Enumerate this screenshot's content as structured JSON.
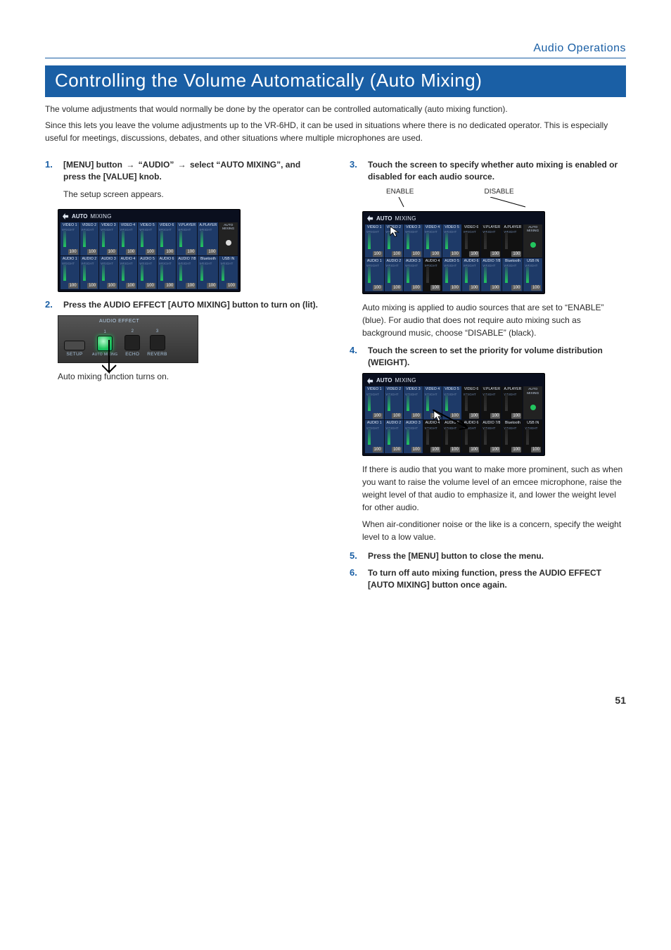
{
  "breadcrumb": "Audio Operations",
  "title": "Controlling the Volume Automatically (Auto Mixing)",
  "intro": {
    "p1": "The volume adjustments that would normally be done by the operator can be controlled automatically (auto mixing function).",
    "p2": "Since this lets you leave the volume adjustments up to the VR-6HD, it can be used in situations where there is no dedicated operator. This is especially useful for meetings, discussions, debates, and other situations where multiple microphones are used."
  },
  "steps": {
    "s1": {
      "num": "1.",
      "lead_a": "[MENU] button ",
      "lead_b": "→ ",
      "lead_c": "“AUDIO” ",
      "lead_d": "→ ",
      "lead_e": "select “AUTO MIXING”, and press the [VALUE] knob.",
      "after": "The setup screen appears."
    },
    "s2": {
      "num": "2.",
      "lead": "Press the AUDIO EFFECT [AUTO MIXING] button to turn on (lit).",
      "after": "Auto mixing function turns on."
    },
    "s3": {
      "num": "3.",
      "lead": "Touch the screen to specify whether auto mixing is enabled or disabled for each audio source.",
      "enable": "ENABLE",
      "disable": "DISABLE",
      "after": "Auto mixing is applied to audio sources that are set to “ENABLE” (blue). For audio that does not require auto mixing such as background music, choose “DISABLE” (black)."
    },
    "s4": {
      "num": "4.",
      "lead": "Touch the screen to set the priority for volume distribution (WEIGHT).",
      "p1": "If there is audio that you want to make more prominent, such as when you want to raise the volume level of an emcee microphone, raise the weight level of that audio to emphasize it, and lower the weight level for other audio.",
      "p2": "When air-conditioner noise or the like is a concern, specify the weight level to a low value."
    },
    "s5": {
      "num": "5.",
      "lead": "Press the [MENU] button to close the menu."
    },
    "s6": {
      "num": "6.",
      "lead": "To turn off auto mixing function, press the AUDIO EFFECT [AUTO MIXING] button once again."
    }
  },
  "devscreen": {
    "title_a": "AUTO",
    "title_b": "MIXING",
    "row_top": [
      "VIDEO 1",
      "VIDEO 2",
      "VIDEO 3",
      "VIDEO 4",
      "VIDEO 5",
      "VIDEO 6",
      "V.PLAYER",
      "A.PLAYER"
    ],
    "row_bottom": [
      "AUDIO 1",
      "AUDIO 2",
      "AUDIO 3",
      "AUDIO 4",
      "AUDIO 5",
      "AUDIO 6",
      "AUDIO 7/8",
      "Bluetooth",
      "USB IN"
    ],
    "auto_mix": "AUTO MIXING",
    "sublabel": "WEIGHT",
    "val": "100"
  },
  "fx": {
    "group": "AUDIO EFFECT",
    "setup": "SETUP",
    "b1": {
      "num": "1",
      "label": "AUTO MIXING"
    },
    "b2": {
      "num": "2",
      "label": "ECHO"
    },
    "b3": {
      "num": "3",
      "label": "REVERB"
    }
  },
  "page_num": "51"
}
